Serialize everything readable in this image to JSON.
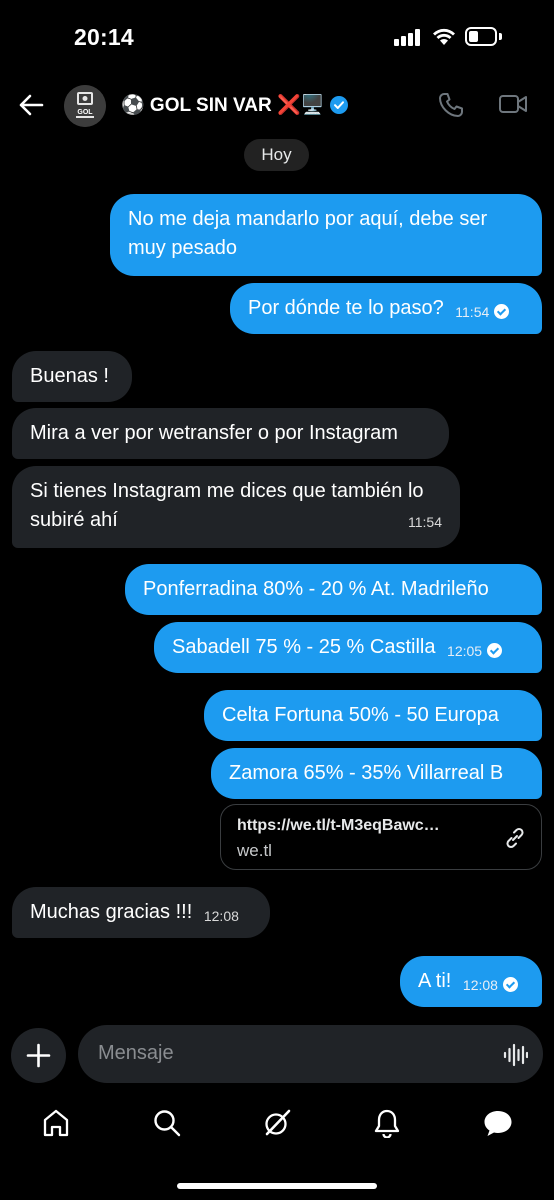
{
  "status_bar": {
    "time": "20:14"
  },
  "header": {
    "title": "⚽ GOL SIN VAR ❌🖥️",
    "avatar_text": "GOL"
  },
  "date_chip": "Hoy",
  "messages": [
    {
      "side": "out",
      "text": "No me deja mandarlo por aquí, debe ser muy pesado"
    },
    {
      "side": "out",
      "text": "Por dónde te lo paso?",
      "time": "11:54",
      "read": true
    },
    {
      "side": "in",
      "text": "Buenas !"
    },
    {
      "side": "in",
      "text": "Mira a ver por wetransfer o por Instagram"
    },
    {
      "side": "in",
      "text": "Si tienes Instagram me dices que también lo subiré ahí",
      "time": "11:54"
    },
    {
      "side": "out",
      "text": "Ponferradina 80% - 20 % At. Madrileño"
    },
    {
      "side": "out",
      "text": "Sabadell 75 % - 25 % Castilla",
      "time": "12:05",
      "read": true
    },
    {
      "side": "out",
      "text": "Celta Fortuna 50% - 50 Europa"
    },
    {
      "side": "out",
      "text": "Zamora 65% - 35% Villarreal B"
    },
    {
      "side": "in",
      "text": "Muchas gracias !!!",
      "time": "12:08"
    },
    {
      "side": "out",
      "text": "A ti!",
      "time": "12:08",
      "read": true
    }
  ],
  "link_card": {
    "url": "https://we.tl/t-M3eqBawc…",
    "host": "we.tl"
  },
  "composer": {
    "placeholder": "Mensaje"
  },
  "nav_icons": [
    "home-icon",
    "search-icon",
    "grok-icon",
    "notifications-icon",
    "messages-icon"
  ],
  "colors": {
    "accent": "#1d9bf0",
    "incoming": "#202327",
    "background": "#000000"
  }
}
